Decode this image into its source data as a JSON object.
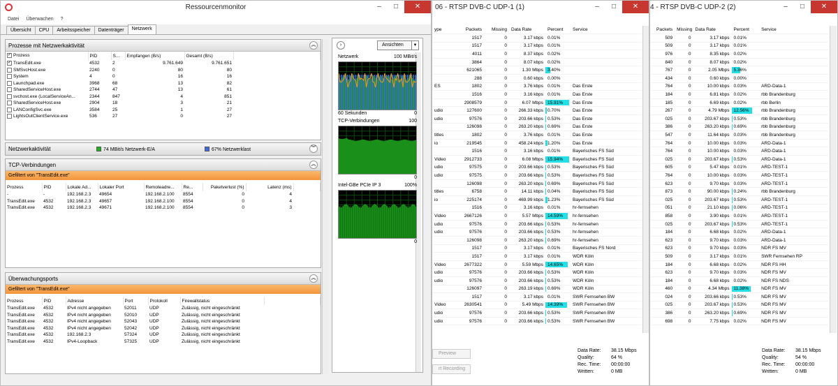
{
  "resmon": {
    "title": "Ressourcenmonitor",
    "menu": [
      "Datei",
      "Überwachen",
      "?"
    ],
    "tabs": [
      "Übersicht",
      "CPU",
      "Arbeitsspeicher",
      "Datenträger",
      "Netzwerk"
    ],
    "active_tab": "Netzwerk",
    "processes": {
      "title": "Prozesse mit Netzwerkaktivität",
      "headers": [
        "Prozess",
        "PID",
        "S...",
        "Empfangen (B/s)",
        "Gesamt (B/s)"
      ],
      "rows": [
        {
          "checked": true,
          "name": "TransEdit.exe",
          "pid": "4532",
          "s": "2",
          "recv": "9.761.649",
          "total": "9.761.651"
        },
        {
          "checked": false,
          "name": "SMSvcHost.exe",
          "pid": "2240",
          "s": "0",
          "recv": "80",
          "total": "80"
        },
        {
          "checked": false,
          "name": "System",
          "pid": "4",
          "s": "0",
          "recv": "16",
          "total": "16"
        },
        {
          "checked": false,
          "name": "Launchpad.exe",
          "pid": "3968",
          "s": "68",
          "recv": "13",
          "total": "82"
        },
        {
          "checked": false,
          "name": "SharedServiceHost.exe",
          "pid": "2744",
          "s": "47",
          "recv": "13",
          "total": "61"
        },
        {
          "checked": false,
          "name": "svchost.exe (LocalServiceAn...",
          "pid": "2344",
          "s": "847",
          "recv": "4",
          "total": "851"
        },
        {
          "checked": false,
          "name": "SharedServiceHost.exe",
          "pid": "2904",
          "s": "18",
          "recv": "3",
          "total": "21"
        },
        {
          "checked": false,
          "name": "LANConfigSvc.exe",
          "pid": "3584",
          "s": "25",
          "recv": "1",
          "total": "27"
        },
        {
          "checked": false,
          "name": "LightsOutClientService.exe",
          "pid": "536",
          "s": "27",
          "recv": "0",
          "total": "27"
        }
      ]
    },
    "netactivity": {
      "title": "Netzwerkaktivität",
      "io": "74 MBit/s Netzwerk-E/A",
      "load": "67% Netzwerklast",
      "io_color": "#1db31d",
      "load_color": "#4169e1"
    },
    "tcp": {
      "title": "TCP-Verbindungen",
      "filter": "Gefiltert von \"TransEdit.exe\"",
      "headers": [
        "Prozess",
        "PID",
        "Lokale Ad...",
        "Lokaler Port",
        "Remoteadre...",
        "Re...",
        "Paketverlust (%)",
        "Latenz (ms)"
      ],
      "rows": [
        [
          "-",
          "-",
          "192.168.2.3",
          "49654",
          "192.168.2.100",
          "8554",
          "0",
          "4"
        ],
        [
          "TransEdit.exe",
          "4532",
          "192.168.2.3",
          "49657",
          "192.168.2.100",
          "8554",
          "0",
          "4"
        ],
        [
          "TransEdit.exe",
          "4532",
          "192.168.2.3",
          "49671",
          "192.168.2.100",
          "8554",
          "0",
          "3"
        ]
      ]
    },
    "ports": {
      "title": "Überwachungsports",
      "filter": "Gefiltert von \"TransEdit.exe\"",
      "headers": [
        "Prozess",
        "PID",
        "Adresse",
        "Port",
        "Protokoll",
        "Firewallstatus"
      ],
      "rows": [
        [
          "TransEdit.exe",
          "4532",
          "IPv4 nicht angegeben",
          "52011",
          "UDP",
          "Zulässig, nicht eingeschränkt"
        ],
        [
          "TransEdit.exe",
          "4532",
          "IPv4 nicht angegeben",
          "52010",
          "UDP",
          "Zulässig, nicht eingeschränkt"
        ],
        [
          "TransEdit.exe",
          "4532",
          "IPv4 nicht angegeben",
          "52043",
          "UDP",
          "Zulässig, nicht eingeschränkt"
        ],
        [
          "TransEdit.exe",
          "4532",
          "IPv4 nicht angegeben",
          "52042",
          "UDP",
          "Zulässig, nicht eingeschränkt"
        ],
        [
          "TransEdit.exe",
          "4532",
          "192.168.2.3",
          "57324",
          "UDP",
          "Zulässig, nicht eingeschränkt"
        ],
        [
          "TransEdit.exe",
          "4532",
          "IPv4-Loopback",
          "57325",
          "UDP",
          "Zulässig, nicht eingeschränkt"
        ]
      ]
    },
    "graphs": {
      "views_button": "Ansichten",
      "network_label": "Netzwerk",
      "network_max": "100 MBit/s",
      "seconds": "60 Sekunden",
      "zero1": "0",
      "tcp_label": "TCP-Verbindungen",
      "tcp_max": "100",
      "zero2": "0",
      "nic_label": "Intel-GBe PCIe IP 3",
      "nic_max": "100%",
      "zero3": "0"
    }
  },
  "udp1": {
    "title": "06 - RTSP DVB-C UDP-1 (1)",
    "headers": [
      "ype",
      "Packets",
      "Missing",
      "Data Rate",
      "Percent",
      "Service"
    ],
    "rows": [
      [
        "",
        "1517",
        "0",
        "3.17 kbps",
        "0.01%",
        ""
      ],
      [
        "",
        "1517",
        "0",
        "3.17 kbps",
        "0.01%",
        ""
      ],
      [
        "",
        "4011",
        "0",
        "8.37 kbps",
        "0.02%",
        ""
      ],
      [
        "",
        "3864",
        "0",
        "8.07 kbps",
        "0.02%",
        ""
      ],
      [
        "",
        "621065",
        "0",
        "1.30 Mbps",
        "3.40%",
        ""
      ],
      [
        "",
        "288",
        "0",
        "0.60 kbps",
        "0.00%",
        ""
      ],
      [
        "ES",
        "1802",
        "0",
        "3.76 kbps",
        "0.01%",
        "Das Erste"
      ],
      [
        "",
        "1516",
        "0",
        "3.16 kbps",
        "0.01%",
        "Das Erste"
      ],
      [
        "",
        "2908579",
        "0",
        "6.07 Mbps",
        "15.91%",
        "Das Erste"
      ],
      [
        "udio",
        "127600",
        "0",
        "266.33 kbps",
        "0.70%",
        "Das Erste"
      ],
      [
        "udio",
        "97576",
        "0",
        "203.66 kbps",
        "0.53%",
        "Das Erste"
      ],
      [
        "",
        "126098",
        "0",
        "263.20 kbps",
        "0.69%",
        "Das Erste"
      ],
      [
        "titles",
        "1802",
        "0",
        "3.76 kbps",
        "0.01%",
        "Das Erste"
      ],
      [
        "io",
        "219545",
        "0",
        "458.24 kbps",
        "1.20%",
        "Das Erste"
      ],
      [
        "",
        "1516",
        "0",
        "3.16 kbps",
        "0.01%",
        "Bayerisches FS Süd"
      ],
      [
        "Video",
        "2912733",
        "0",
        "6.08 Mbps",
        "15.94%",
        "Bayerisches FS Süd"
      ],
      [
        "udio",
        "97575",
        "0",
        "203.66 kbps",
        "0.53%",
        "Bayerisches FS Süd"
      ],
      [
        "udio",
        "97575",
        "0",
        "203.66 kbps",
        "0.53%",
        "Bayerisches FS Süd"
      ],
      [
        "",
        "126098",
        "0",
        "263.20 kbps",
        "0.69%",
        "Bayerisches FS Süd"
      ],
      [
        "titles",
        "6758",
        "0",
        "14.11 kbps",
        "0.04%",
        "Bayerisches FS Süd"
      ],
      [
        "io",
        "225174",
        "0",
        "469.99 kbps",
        "1.23%",
        "Bayerisches FS Süd"
      ],
      [
        "",
        "1516",
        "0",
        "3.16 kbps",
        "0.01%",
        "hr-fernsehen"
      ],
      [
        "Video",
        "2667126",
        "0",
        "5.57 Mbps",
        "14.59%",
        "hr-fernsehen"
      ],
      [
        "udio",
        "97576",
        "0",
        "203.66 kbps",
        "0.53%",
        "hr-fernsehen"
      ],
      [
        "udio",
        "97576",
        "0",
        "203.66 kbps",
        "0.53%",
        "hr-fernsehen"
      ],
      [
        "",
        "126098",
        "0",
        "263.20 kbps",
        "0.69%",
        "hr-fernsehen"
      ],
      [
        "",
        "1517",
        "0",
        "3.17 kbps",
        "0.01%",
        "Bayerisches FS Nord"
      ],
      [
        "",
        "1517",
        "0",
        "3.17 kbps",
        "0.01%",
        "WDR Köln"
      ],
      [
        "Video",
        "2677322",
        "0",
        "5.59 Mbps",
        "14.65%",
        "WDR Köln"
      ],
      [
        "udio",
        "97576",
        "0",
        "203.66 kbps",
        "0.53%",
        "WDR Köln"
      ],
      [
        "udio",
        "97576",
        "0",
        "203.66 kbps",
        "0.53%",
        "WDR Köln"
      ],
      [
        "",
        "126097",
        "0",
        "263.19 kbps",
        "0.69%",
        "WDR Köln"
      ],
      [
        "",
        "1517",
        "0",
        "3.17 kbps",
        "0.01%",
        "SWR Fernsehen BW"
      ],
      [
        "Video",
        "2630541",
        "0",
        "5.49 Mbps",
        "14.39%",
        "SWR Fernsehen BW"
      ],
      [
        "udio",
        "97576",
        "0",
        "203.66 kbps",
        "0.53%",
        "SWR Fernsehen BW"
      ],
      [
        "udio",
        "97576",
        "0",
        "203.66 kbps",
        "0.53%",
        "SWR Fernsehen BW"
      ]
    ],
    "preview": "Preview",
    "recording": "rt Recording",
    "stats": {
      "rate_label": "Data Rate:",
      "rate": "38.15 Mbps",
      "quality_label": "Quality:",
      "quality": "64 %",
      "rectime_label": "Rec. Time:",
      "rectime": "00:00:00",
      "written_label": "Written:",
      "written": "0 MB"
    }
  },
  "udp2": {
    "title": "4 - RTSP DVB-C UDP-2 (2)",
    "headers": [
      "ype",
      "Packets",
      "Missing",
      "Data Rate",
      "Percent",
      "Service"
    ],
    "rows": [
      [
        "",
        "509",
        "0",
        "3.17 kbps",
        "0.01%",
        ""
      ],
      [
        "",
        "509",
        "0",
        "3.17 kbps",
        "0.01%",
        ""
      ],
      [
        "",
        "976",
        "0",
        "8.35 kbps",
        "0.02%",
        ""
      ],
      [
        "",
        "840",
        "0",
        "8.07 kbps",
        "0.02%",
        ""
      ],
      [
        "",
        "767",
        "0",
        "2.05 Mbps",
        "5.36%",
        ""
      ],
      [
        "",
        "434",
        "0",
        "0.60 kbps",
        "0.00%",
        ""
      ],
      [
        "",
        "764",
        "0",
        "10.00 kbps",
        "0.03%",
        "ARD-Data-1"
      ],
      [
        "",
        "184",
        "0",
        "6.81 kbps",
        "0.02%",
        "rbb Brandenburg"
      ],
      [
        "",
        "185",
        "0",
        "6.69 kbps",
        "0.02%",
        "rbb Berlin"
      ],
      [
        "",
        "267",
        "0",
        "4.79 Mbps",
        "12.56%",
        "rbb Brandenburg"
      ],
      [
        "",
        "025",
        "0",
        "203.67 kbps",
        "0.53%",
        "rbb Brandenburg"
      ],
      [
        "",
        "386",
        "0",
        "263.20 kbps",
        "0.69%",
        "rbb Brandenburg"
      ],
      [
        "",
        "547",
        "0",
        "11.64 kbps",
        "0.03%",
        "rbb Brandenburg"
      ],
      [
        "",
        "764",
        "0",
        "10.00 kbps",
        "0.03%",
        "ARD-Data-1"
      ],
      [
        "",
        "764",
        "0",
        "10.00 kbps",
        "0.03%",
        "ARD-Data-1"
      ],
      [
        "",
        "025",
        "0",
        "203.67 kbps",
        "0.53%",
        "ARD-Data-1"
      ],
      [
        "",
        "605",
        "0",
        "5.47 kbps",
        "0.01%",
        "ARD-TEST-1"
      ],
      [
        "",
        "764",
        "0",
        "10.00 kbps",
        "0.03%",
        "ARD-TEST-1"
      ],
      [
        "",
        "623",
        "0",
        "9.70 kbps",
        "0.03%",
        "ARD-TEST-1"
      ],
      [
        "",
        "873",
        "0",
        "90.00 kbps",
        "0.24%",
        "rbb Brandenburg"
      ],
      [
        "",
        "025",
        "0",
        "203.67 kbps",
        "0.53%",
        "ARD-TEST-1"
      ],
      [
        "",
        "051",
        "0",
        "21.10 kbps",
        "0.06%",
        "ARD-TEST-1"
      ],
      [
        "",
        "858",
        "0",
        "3.90 kbps",
        "0.01%",
        "ARD-TEST-1"
      ],
      [
        "",
        "025",
        "0",
        "203.67 kbps",
        "0.53%",
        "ARD-TEST-1"
      ],
      [
        "",
        "184",
        "0",
        "6.68 kbps",
        "0.02%",
        "ARD-Data-1"
      ],
      [
        "",
        "623",
        "0",
        "9.70 kbps",
        "0.03%",
        "ARD-Data-1"
      ],
      [
        "",
        "623",
        "0",
        "9.70 kbps",
        "0.03%",
        "NDR FS MV"
      ],
      [
        "",
        "509",
        "0",
        "3.17 kbps",
        "0.01%",
        "SWR Fernsehen RP"
      ],
      [
        "",
        "184",
        "0",
        "6.68 kbps",
        "0.02%",
        "NDR FS HH"
      ],
      [
        "",
        "623",
        "0",
        "9.70 kbps",
        "0.03%",
        "NDR FS MV"
      ],
      [
        "",
        "184",
        "0",
        "6.68 kbps",
        "0.02%",
        "NDR FS NDS"
      ],
      [
        "",
        "460",
        "0",
        "4.34 Mbps",
        "11.38%",
        "NDR FS MV"
      ],
      [
        "",
        "024",
        "0",
        "203.66 kbps",
        "0.53%",
        "NDR FS MV"
      ],
      [
        "",
        "025",
        "0",
        "203.67 kbps",
        "0.53%",
        "NDR FS MV"
      ],
      [
        "",
        "386",
        "0",
        "263.20 kbps",
        "0.69%",
        "NDR FS MV"
      ],
      [
        "",
        "698",
        "0",
        "7.75 kbps",
        "0.02%",
        "NDR FS MV"
      ]
    ],
    "stats": {
      "rate_label": "Data Rate:",
      "rate": "38.15 Mbps",
      "quality_label": "Quality:",
      "quality": "54 %",
      "rectime_label": "Rec. Time:",
      "rectime": "00:00:00",
      "written_label": "Written:",
      "written": "0 MB"
    }
  },
  "window_buttons": {
    "min": "–",
    "max": "□",
    "close": "✕"
  }
}
